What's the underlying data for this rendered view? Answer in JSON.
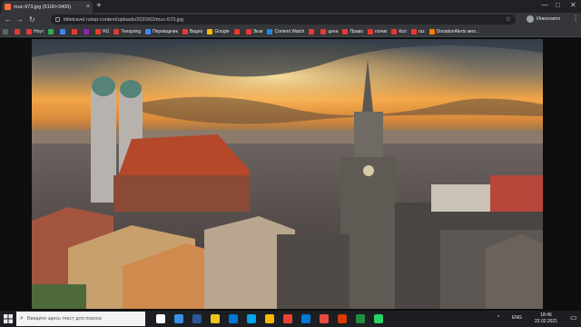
{
  "browser": {
    "tab_title": "muc-673.jpg (5100×3400)",
    "new_tab_symbol": "+",
    "tab_close_symbol": "×",
    "window_controls": [
      "—",
      "□",
      "✕"
    ],
    "url": "littletravel.ru/wp-content/uploads/2020/02/muc-673.jpg",
    "profile_name": "Инкогнито",
    "nav": {
      "back": "←",
      "forward": "→",
      "reload": "↻",
      "star": "☆",
      "menu": "⋮"
    }
  },
  "bookmarks": [
    {
      "label": "",
      "color": "#5f6368"
    },
    {
      "label": "",
      "color": "#e53935"
    },
    {
      "label": "Ноут",
      "color": "#e53935"
    },
    {
      "label": "",
      "color": "#34a853"
    },
    {
      "label": "",
      "color": "#4285f4"
    },
    {
      "label": "",
      "color": "#e53935"
    },
    {
      "label": "",
      "color": "#8e24aa"
    },
    {
      "label": "RU",
      "color": "#e53935"
    },
    {
      "label": "Teespring",
      "color": "#e53935"
    },
    {
      "label": "Переводчик",
      "color": "#4285f4"
    },
    {
      "label": "Видео",
      "color": "#e53935"
    },
    {
      "label": "Google",
      "color": "#fbbc05"
    },
    {
      "label": "",
      "color": "#e53935"
    },
    {
      "label": "Экзи",
      "color": "#e53935"
    },
    {
      "label": "Content Watch",
      "color": "#1e88e5"
    },
    {
      "label": "",
      "color": "#e53935"
    },
    {
      "label": "цена",
      "color": "#e53935"
    },
    {
      "label": "Право",
      "color": "#e53935"
    },
    {
      "label": "полик",
      "color": "#e53935"
    },
    {
      "label": "Кол",
      "color": "#e53935"
    },
    {
      "label": "газ",
      "color": "#e53935"
    },
    {
      "label": "DonationAlerts мил...",
      "color": "#f57c00"
    }
  ],
  "taskbar": {
    "search_placeholder": "Введите здесь текст для поиска",
    "language": "ENG",
    "time": "18:46",
    "date": "22.02.2021",
    "pinned": [
      "#ffffff",
      "#3a8ee6",
      "#2b579a",
      "#f0c419",
      "#0078d4",
      "#00a4ef",
      "#ffb900",
      "#ea4335",
      "#0078d7",
      "#e74c3c",
      "#d83b01",
      "#1e8e3e",
      "#25d366"
    ]
  },
  "colors": {
    "sky_top": "#3d4a58",
    "sky_glow": "#f4a540",
    "roof": "#b5472b"
  }
}
